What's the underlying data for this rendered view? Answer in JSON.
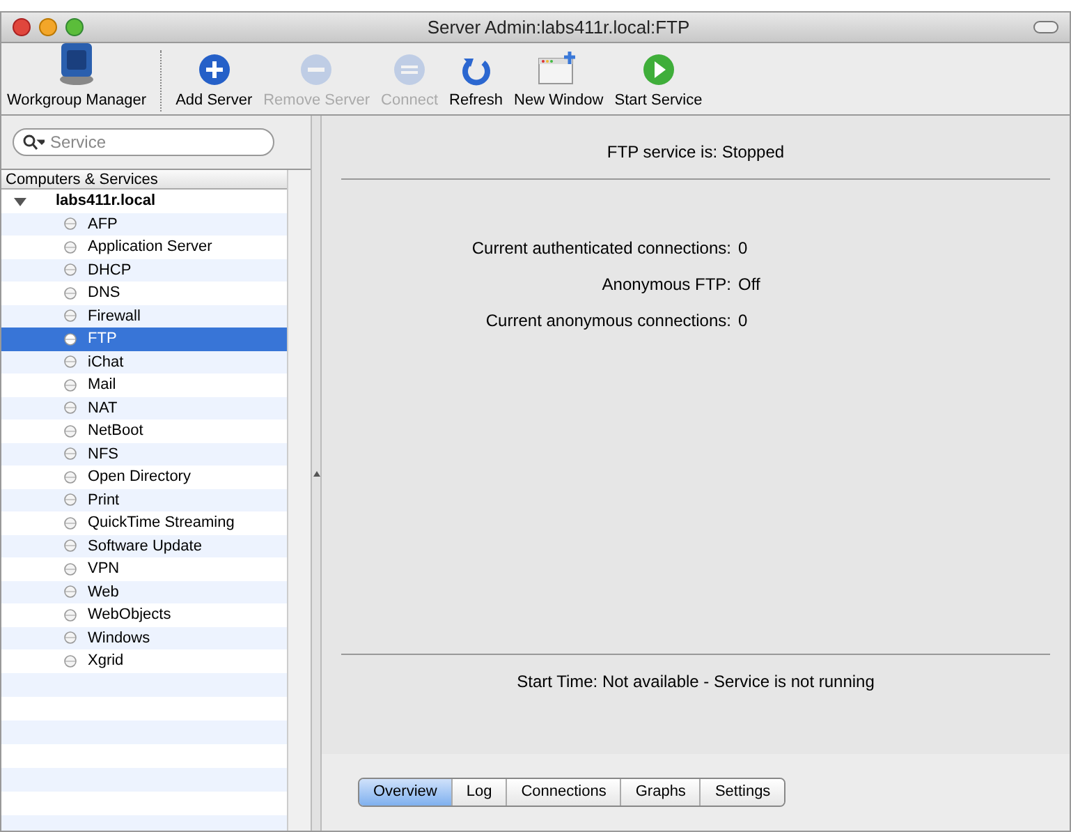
{
  "window": {
    "title": "Server Admin:labs411r.local:FTP"
  },
  "toolbar": [
    {
      "kind": "workgroup",
      "label": "Workgroup Manager",
      "disabled": false
    },
    {
      "kind": "add",
      "label": "Add Server",
      "disabled": false
    },
    {
      "kind": "remove",
      "label": "Remove Server",
      "disabled": true
    },
    {
      "kind": "connect",
      "label": "Connect",
      "disabled": true
    },
    {
      "kind": "refresh",
      "label": "Refresh",
      "disabled": false
    },
    {
      "kind": "window",
      "label": "New Window",
      "disabled": false
    },
    {
      "kind": "start",
      "label": "Start Service",
      "disabled": false
    }
  ],
  "sidebar": {
    "search": {
      "placeholder": "Service"
    },
    "header": "Computers & Services",
    "server": {
      "label": "labs411r.local",
      "expanded": true,
      "children": [
        {
          "label": "AFP",
          "selected": false
        },
        {
          "label": "Application Server",
          "selected": false
        },
        {
          "label": "DHCP",
          "selected": false
        },
        {
          "label": "DNS",
          "selected": false
        },
        {
          "label": "Firewall",
          "selected": false
        },
        {
          "label": "FTP",
          "selected": true
        },
        {
          "label": "iChat",
          "selected": false
        },
        {
          "label": "Mail",
          "selected": false
        },
        {
          "label": "NAT",
          "selected": false
        },
        {
          "label": "NetBoot",
          "selected": false
        },
        {
          "label": "NFS",
          "selected": false
        },
        {
          "label": "Open Directory",
          "selected": false
        },
        {
          "label": "Print",
          "selected": false
        },
        {
          "label": "QuickTime Streaming",
          "selected": false
        },
        {
          "label": "Software Update",
          "selected": false
        },
        {
          "label": "VPN",
          "selected": false
        },
        {
          "label": "Web",
          "selected": false
        },
        {
          "label": "WebObjects",
          "selected": false
        },
        {
          "label": "Windows",
          "selected": false
        },
        {
          "label": "Xgrid",
          "selected": false
        }
      ]
    }
  },
  "content": {
    "status": "FTP service is:  Stopped",
    "fields": [
      {
        "label": "Current authenticated connections:",
        "value": "0"
      },
      {
        "label": "Anonymous FTP:",
        "value": "Off"
      },
      {
        "label": "Current anonymous connections:",
        "value": "0"
      }
    ],
    "start_time": "Start Time: Not available - Service is not running"
  },
  "tabs": [
    {
      "label": "Overview",
      "selected": true
    },
    {
      "label": "Log",
      "selected": false
    },
    {
      "label": "Connections",
      "selected": false
    },
    {
      "label": "Graphs",
      "selected": false
    },
    {
      "label": "Settings",
      "selected": false
    }
  ]
}
